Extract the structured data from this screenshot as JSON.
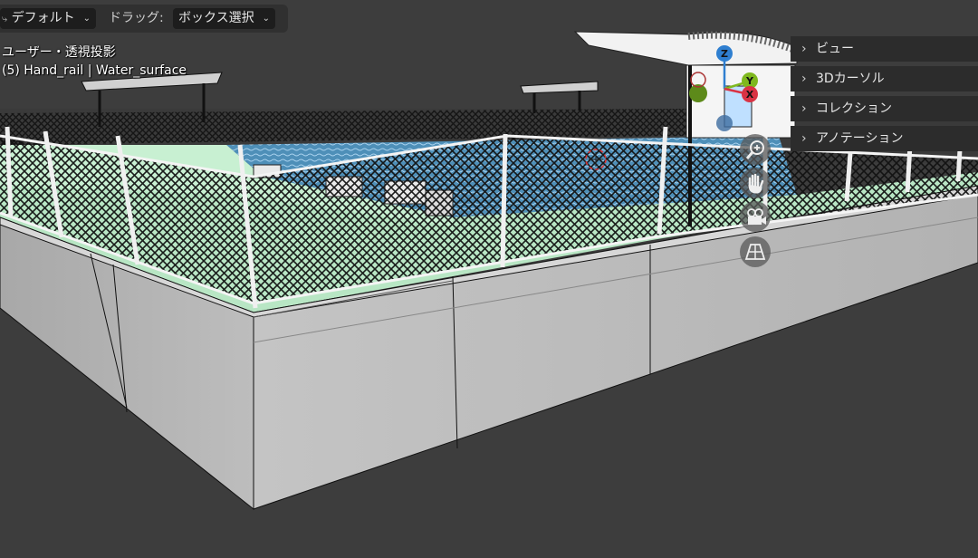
{
  "header": {
    "orientation_icon": "transform-orientation-icon",
    "orientation_label": "デフォルト",
    "drag_label": "ドラッグ:",
    "drag_value": "ボックス選択"
  },
  "viewport": {
    "view_name": "ユーザー・透視投影",
    "object_info": "(5) Hand_rail | Water_surface"
  },
  "npanel": {
    "tabs": [
      {
        "label": "ビュー"
      },
      {
        "label": "3Dカーソル"
      },
      {
        "label": "コレクション"
      },
      {
        "label": "アノテーション"
      }
    ]
  },
  "gizmo": {
    "axes": [
      {
        "label": "Z",
        "color": "#2f7fd0"
      },
      {
        "label": "Y",
        "color": "#7fb81e"
      },
      {
        "label": "X",
        "color": "#d93344"
      }
    ]
  },
  "nav_buttons": [
    "zoom-icon",
    "hand-pan-icon",
    "camera-icon",
    "grid-perspective-icon"
  ],
  "colors": {
    "background": "#3d3d3d",
    "wall": "#b9b9b9",
    "grass": "#b8e6c4",
    "water": "#4e8fb8",
    "fence": "#101010"
  }
}
